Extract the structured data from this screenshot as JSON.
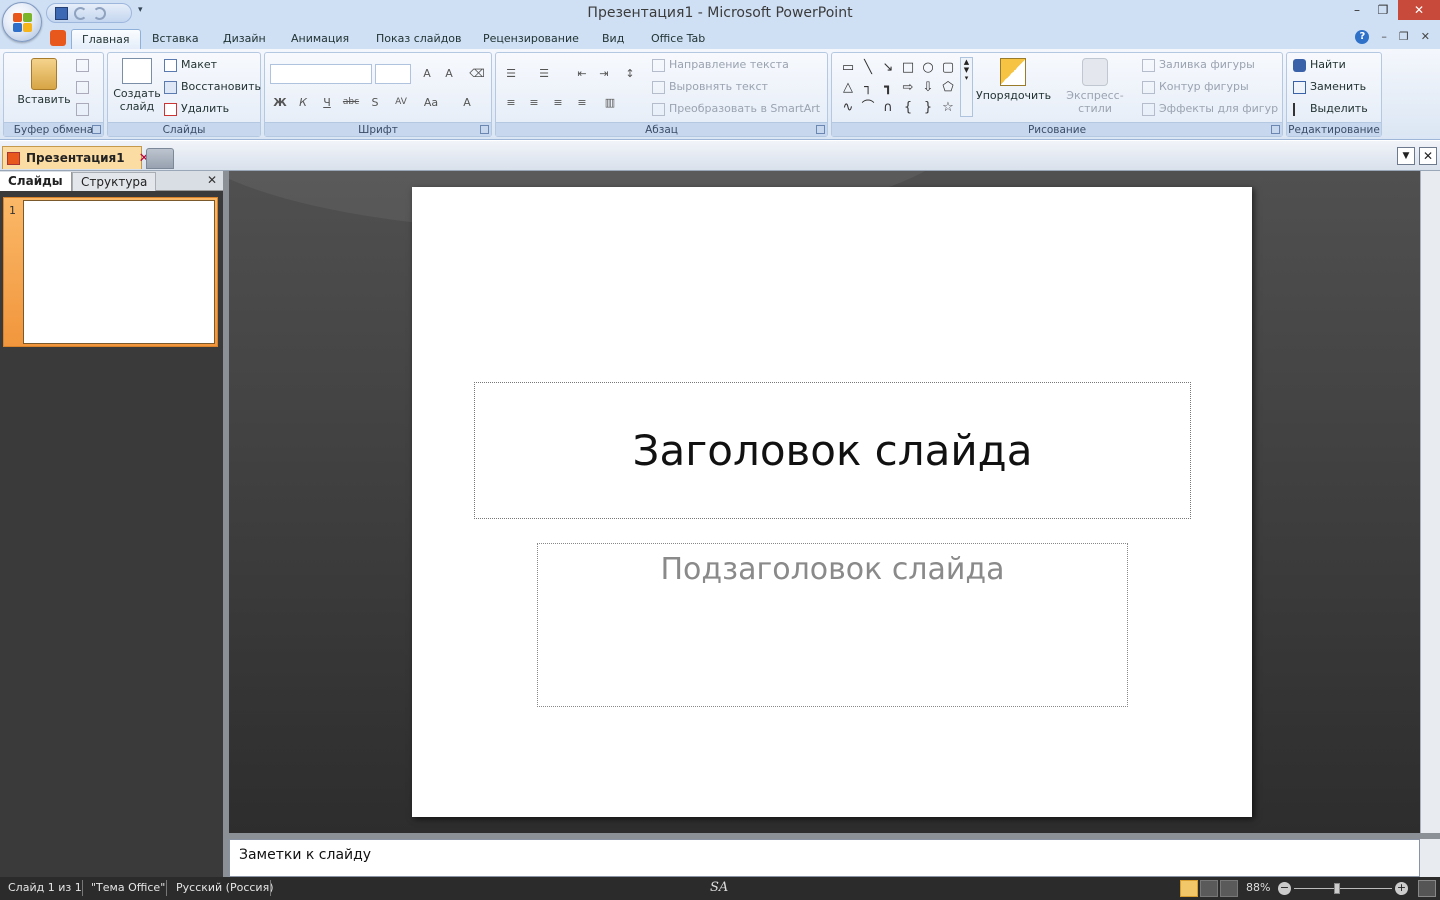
{
  "window": {
    "title": "Презентация1 - Microsoft PowerPoint",
    "min": "–",
    "max": "❐",
    "close": "✕"
  },
  "qat": {
    "more": "▾"
  },
  "tabs": [
    {
      "label": "Главная",
      "active": true
    },
    {
      "label": "Вставка"
    },
    {
      "label": "Дизайн"
    },
    {
      "label": "Анимация"
    },
    {
      "label": "Показ слайдов"
    },
    {
      "label": "Рецензирование"
    },
    {
      "label": "Вид"
    },
    {
      "label": "Office Tab"
    }
  ],
  "ribbon": {
    "clipboard": {
      "label": "Буфер обмена",
      "paste": "Вставить"
    },
    "slides": {
      "label": "Слайды",
      "new_slide": "Создать слайд",
      "layout": "Макет",
      "reset": "Восстановить",
      "delete": "Удалить"
    },
    "font": {
      "label": "Шрифт",
      "bold": "Ж",
      "italic": "К",
      "underline": "Ч",
      "strike": "abc",
      "shadow": "S",
      "spacing": "AV",
      "case": "Aa",
      "color": "A"
    },
    "paragraph": {
      "label": "Абзац",
      "text_direction": "Направление текста",
      "align_text": "Выровнять текст",
      "smartart": "Преобразовать в SmartArt"
    },
    "drawing": {
      "label": "Рисование",
      "arrange": "Упорядочить",
      "quick_styles": "Экспресс-стили",
      "fill": "Заливка фигуры",
      "outline": "Контур фигуры",
      "effects": "Эффекты для фигур"
    },
    "editing": {
      "label": "Редактирование",
      "find": "Найти",
      "replace": "Заменить",
      "select": "Выделить"
    }
  },
  "doc_tabs": [
    {
      "label": "Презентация1"
    }
  ],
  "left_panel": {
    "tab_slides": "Слайды",
    "tab_outline": "Структура",
    "thumb_number": "1"
  },
  "slide": {
    "title": "Заголовок слайда",
    "subtitle": "Подзаголовок слайда"
  },
  "notes": {
    "placeholder": "Заметки к слайду"
  },
  "status": {
    "slide": "Слайд 1 из 1",
    "theme": "\"Тема Office\"",
    "language": "Русский (Россия)",
    "signature": "SA",
    "zoom": "88%",
    "zoom_fraction": 0.44
  },
  "colors": {
    "accent": "#f1963d",
    "ribbon_bg": "#dbe6f4",
    "workspace": "#3a3a3a"
  }
}
